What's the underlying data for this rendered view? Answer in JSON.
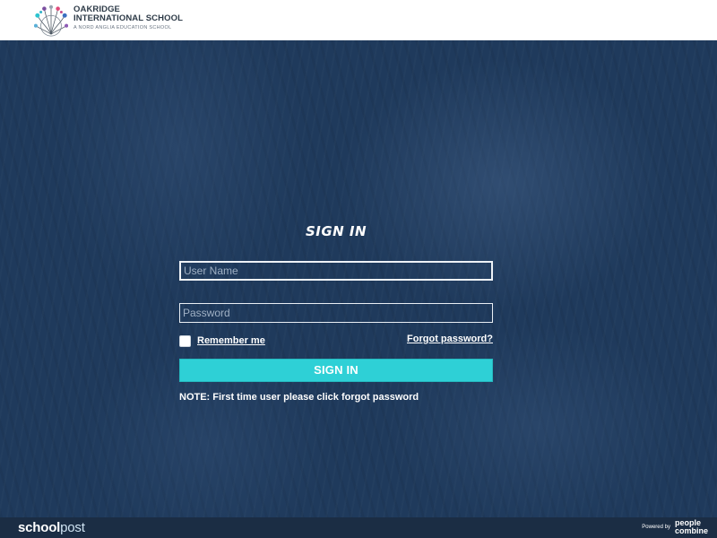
{
  "header": {
    "school_name_line1": "OAKRIDGE",
    "school_name_line2": "INTERNATIONAL SCHOOL",
    "school_subtitle": "A NORD ANGLIA EDUCATION SCHOOL",
    "logo_icon": "flower-logo-icon"
  },
  "login": {
    "title": "SIGN IN",
    "username_placeholder": "User Name",
    "username_value": "",
    "password_placeholder": "Password",
    "password_value": "",
    "remember_label": "Remember me",
    "remember_checked": false,
    "forgot_label": "Forgot password?",
    "signin_label": "SIGN IN",
    "note": "NOTE: First time user please click forgot password"
  },
  "footer": {
    "brand_part1": "school",
    "brand_part2": "post",
    "powered_label": "Powered by",
    "powered_brand_line1": "people",
    "powered_brand_line2": "combine"
  },
  "colors": {
    "background": "#1f3a5c",
    "accent": "#2ed0d6",
    "footer": "#1b2d44",
    "header": "#ffffff"
  }
}
